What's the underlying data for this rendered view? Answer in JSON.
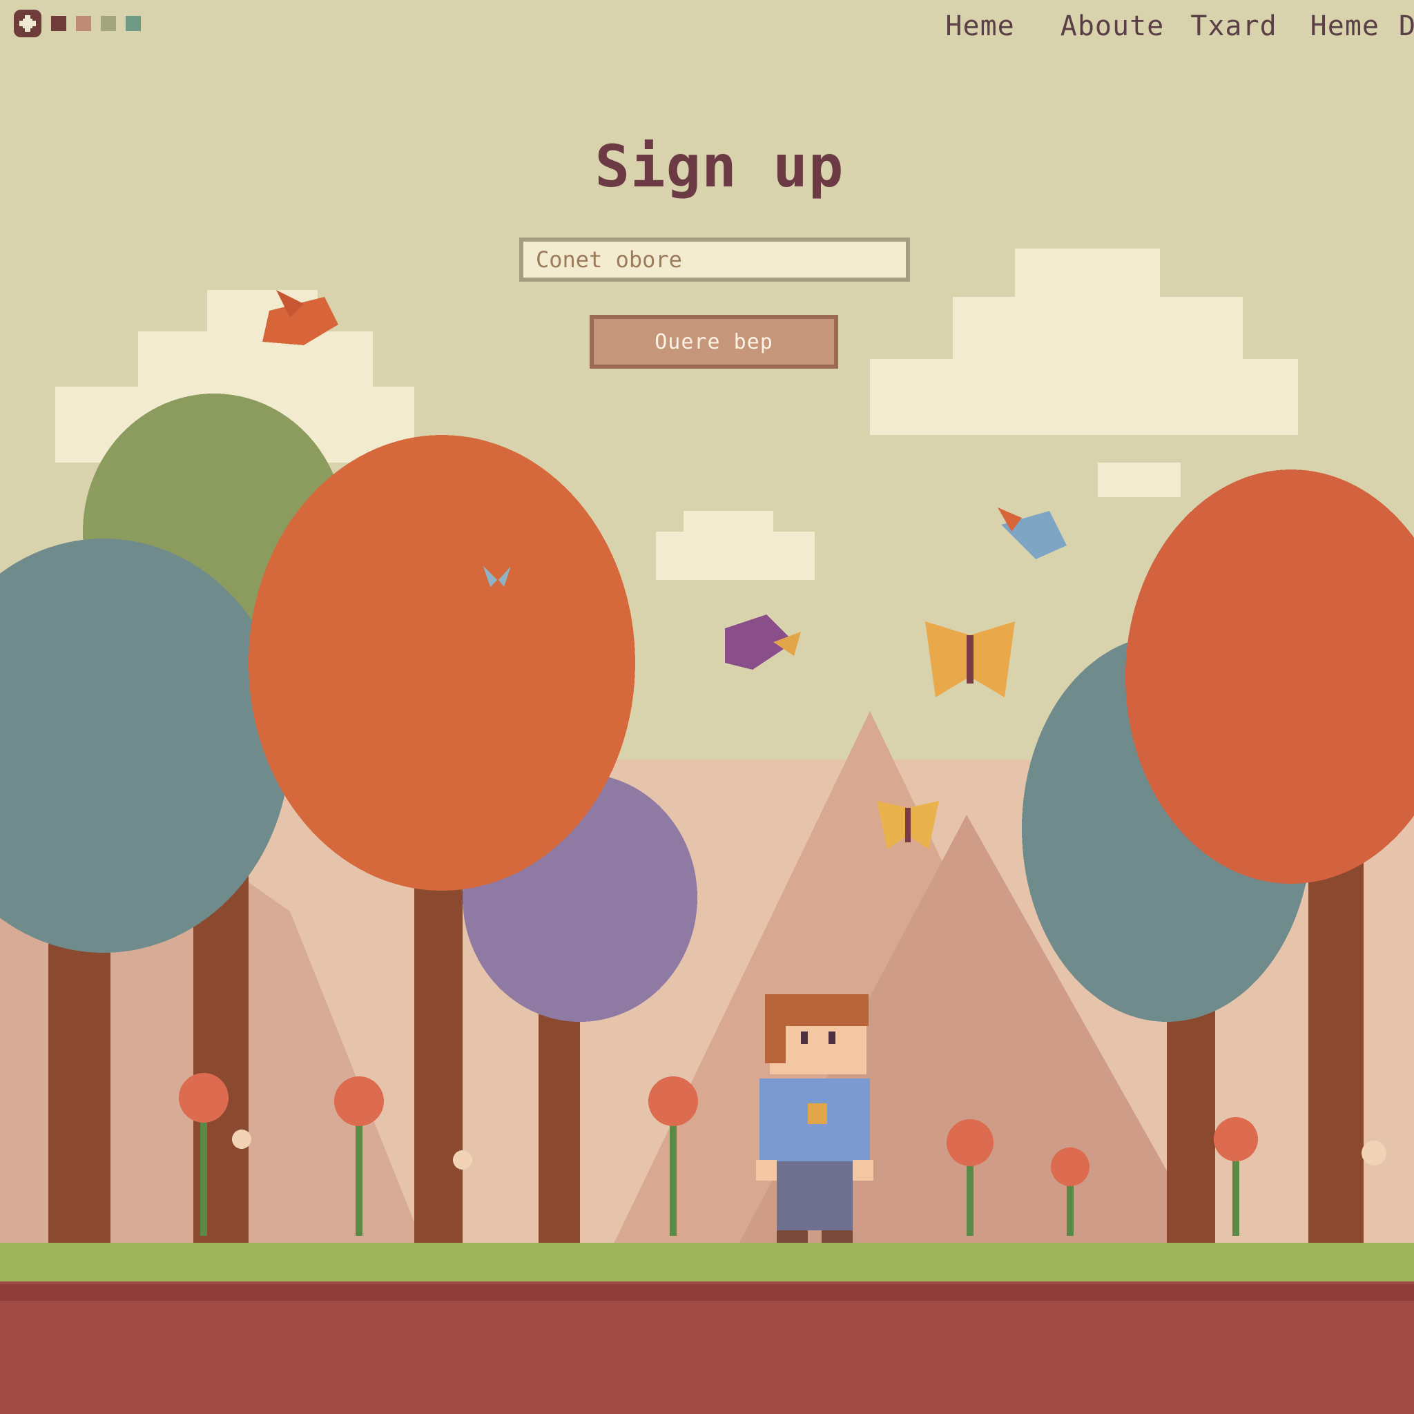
{
  "header": {
    "logo": {
      "icon": "pixel-flower-icon"
    },
    "swatches": [
      "#6e3d3a",
      "#c08b74",
      "#a2a67a",
      "#6f9a86"
    ],
    "nav": [
      {
        "label": "Heme"
      },
      {
        "label": "Aboute"
      },
      {
        "label": "Txard"
      },
      {
        "label": "Heme"
      },
      {
        "label": "D"
      }
    ]
  },
  "form": {
    "title": "Sign up",
    "input_placeholder": "Conet obore",
    "submit_label": "Ouere bep"
  },
  "colors": {
    "sky": "#d8d2ad",
    "cloud": "#f3ebcf",
    "mountain": "#d8a891",
    "haze": "#e5c4ab",
    "grass": "#9fb55c",
    "soil": "#a04b45",
    "trunk": "#8b4a2f",
    "autumn_orange": "#d6693b",
    "autumn_green": "#8c9b5e",
    "autumn_blue": "#6f8b8b",
    "autumn_purple": "#8f7aa3",
    "flower_red": "#dd6b4f"
  },
  "scene": {
    "birds": [
      {
        "icon": "red-bird-icon",
        "color": "#d8643a"
      },
      {
        "icon": "blue-bird-icon",
        "color": "#7ea6c4"
      },
      {
        "icon": "purple-bird-icon",
        "color": "#8a4f8a"
      }
    ],
    "butterflies": [
      {
        "icon": "butterfly-icon",
        "color": "#e9a94a"
      },
      {
        "icon": "butterfly-icon",
        "color": "#e9b24d"
      },
      {
        "icon": "small-butterfly-icon",
        "color": "#8fb2c4"
      }
    ],
    "character": {
      "icon": "pixel-boy-icon",
      "shirt_color": "#7b9bd0",
      "hair_color": "#b7643a"
    }
  }
}
